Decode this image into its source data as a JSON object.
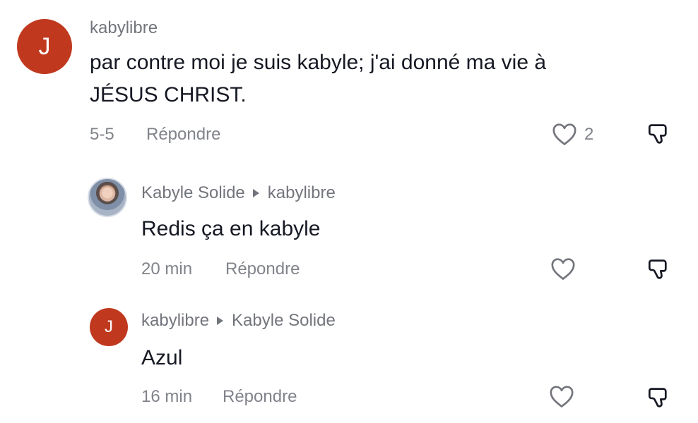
{
  "comments": [
    {
      "username": "kabylibre",
      "avatar_letter": "J",
      "avatar_color": "#c0391f",
      "text_line1": "par contre moi je suis kabyle; j'ai donné ma vie à",
      "text_line2": "JÉSUS CHRIST.",
      "date": "5-5",
      "reply_label": "Répondre",
      "like_count": "2",
      "like_icon": "heart-outline-icon",
      "dislike_icon": "thumbs-down-outline-icon"
    },
    {
      "username": "Kabyle Solide",
      "reply_to": "kabylibre",
      "text": "Redis ça en kabyle",
      "date": "20 min",
      "reply_label": "Répondre",
      "like_icon": "heart-outline-icon",
      "dislike_icon": "thumbs-down-outline-icon"
    },
    {
      "username": "kabylibre",
      "reply_to": "Kabyle Solide",
      "avatar_letter": "J",
      "avatar_color": "#c0391f",
      "text": "Azul",
      "date": "16 min",
      "reply_label": "Répondre",
      "like_icon": "heart-outline-icon",
      "dislike_icon": "thumbs-down-outline-icon"
    }
  ],
  "colors": {
    "text": "#161823",
    "muted": "#73757c",
    "avatar_red": "#c0391f"
  }
}
